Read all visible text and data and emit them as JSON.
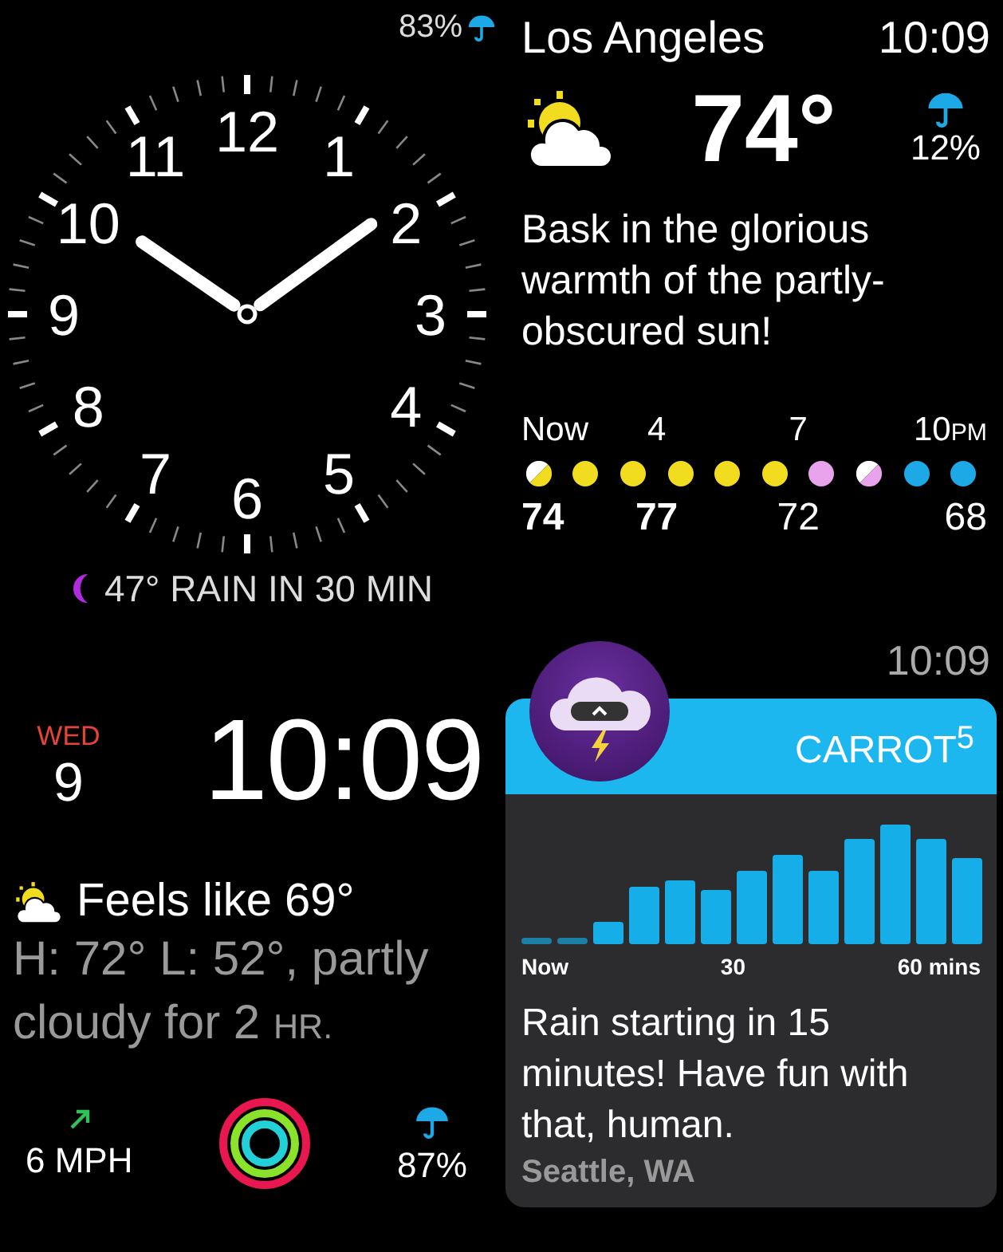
{
  "analog_face": {
    "battery": "83%",
    "numerals": [
      "12",
      "11",
      "1",
      "10",
      "2",
      "9",
      "3",
      "8",
      "4",
      "7",
      "5",
      "6"
    ],
    "forecast": "47° RAIN IN 30 MIN"
  },
  "weather_face": {
    "city": "Los Angeles",
    "time": "10:09",
    "temperature": "74°",
    "rain_chance": "12%",
    "message": "Bask in the glorious warmth of the partly-obscured sun!",
    "hours": [
      {
        "text": "Now"
      },
      {
        "text": "4"
      },
      {
        "text": "7"
      },
      {
        "text": "10",
        "suffix": "PM"
      }
    ],
    "dots": [
      {
        "kind": "split",
        "color": "#f2dc1f"
      },
      {
        "kind": "full",
        "color": "#f2dc1f"
      },
      {
        "kind": "full",
        "color": "#f2dc1f"
      },
      {
        "kind": "full",
        "color": "#f2dc1f"
      },
      {
        "kind": "full",
        "color": "#f2dc1f"
      },
      {
        "kind": "full",
        "color": "#f2dc1f"
      },
      {
        "kind": "full",
        "color": "#e9a2ec"
      },
      {
        "kind": "split",
        "color": "#e9a2ec"
      },
      {
        "kind": "full",
        "color": "#1da9e6"
      },
      {
        "kind": "full",
        "color": "#1da9e6"
      }
    ],
    "temps": [
      {
        "text": "74",
        "bold": true
      },
      {
        "text": "77",
        "bold": true
      },
      {
        "text": "72",
        "bold": false
      },
      {
        "text": "68",
        "bold": false
      }
    ]
  },
  "modular_face": {
    "weekday": "WED",
    "day": "9",
    "time": "10:09",
    "feels_like": "Feels like 69°",
    "summary": "H: 72° L: 52°, partly cloudy for 2",
    "summary_unit": "HR.",
    "wind": "6 MPH",
    "rain_chance": "87%"
  },
  "carrot_face": {
    "time": "10:09",
    "app_name": "CARROT$^{5}$",
    "axis_labels": [
      "Now",
      "30",
      "60 mins"
    ],
    "message": "Rain starting in 15 minutes! Have fun with that, human.",
    "location": "Seattle, WA"
  }
}
